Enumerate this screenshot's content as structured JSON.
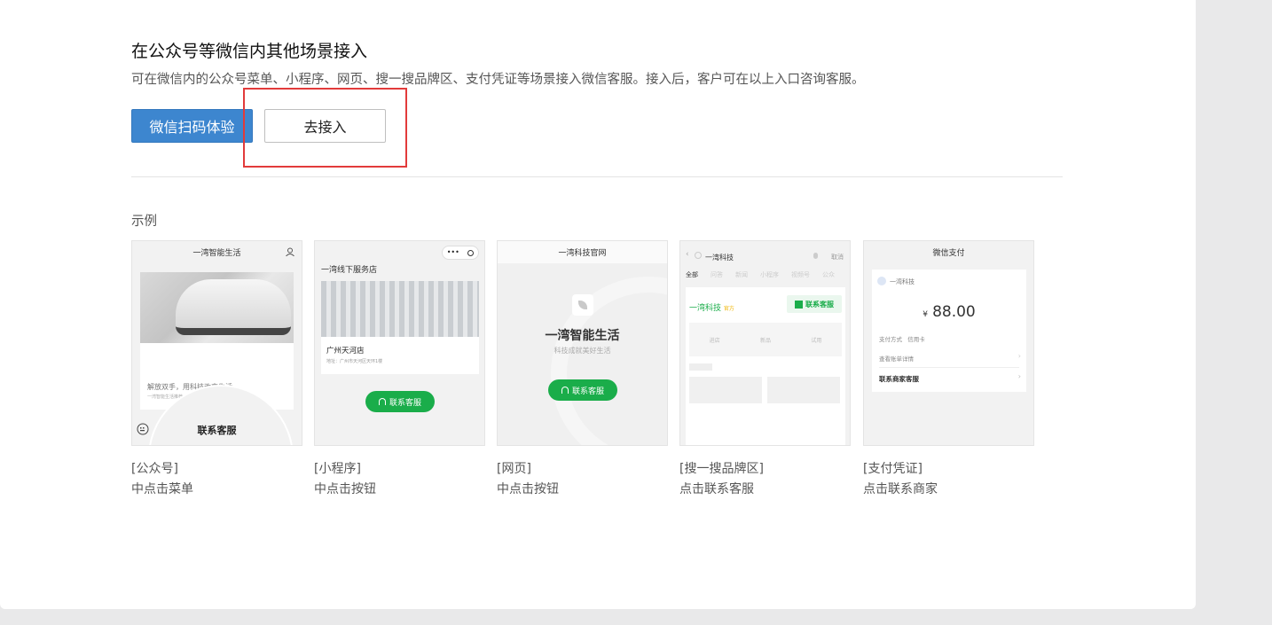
{
  "section": {
    "title": "在公众号等微信内其他场景接入",
    "description": "可在微信内的公众号菜单、小程序、网页、搜一搜品牌区、支付凭证等场景接入微信客服。接入后，客户可在以上入口咨询客服。",
    "scan_button": "微信扫码体验",
    "connect_button": "去接入"
  },
  "examples": {
    "label": "示例",
    "cards": [
      {
        "header": "一湾智能生活",
        "line1": "解放双手，用科技改变生活",
        "line2": "一湾智能生活推荐",
        "bottom": "联系客服",
        "caption1": "[公众号]",
        "caption2": "中点击菜单"
      },
      {
        "header": "一湾线下服务店",
        "store_name": "广州天河店",
        "address": "地址：广州市天河区天环1楼",
        "button": "联系客服",
        "caption1": "[小程序]",
        "caption2": "中点击按钮"
      },
      {
        "header": "一湾科技官网",
        "brand": "一湾智能生活",
        "slogan": "科技成就美好生活",
        "button": "联系客服",
        "caption1": "[网页]",
        "caption2": "中点击按钮"
      },
      {
        "header": "一湾科技",
        "header_right": "取消",
        "tabs": [
          "全部",
          "问答",
          "新闻",
          "小程序",
          "视频号",
          "公众"
        ],
        "brand": "一湾科技",
        "brand_tag": "官方",
        "button": "联系客服",
        "icons": [
          "进店",
          "新品",
          "试用"
        ],
        "caption1": "[搜一搜品牌区]",
        "caption2": "点击联系客服"
      },
      {
        "header": "微信支付",
        "merchant": "一湾科技",
        "currency": "¥",
        "amount": "88.00",
        "method_label": "支付方式",
        "method_value": "信用卡",
        "detail": "查看账单详情",
        "contact": "联系商家客服",
        "caption1": "[支付凭证]",
        "caption2": "点击联系商家"
      }
    ]
  }
}
